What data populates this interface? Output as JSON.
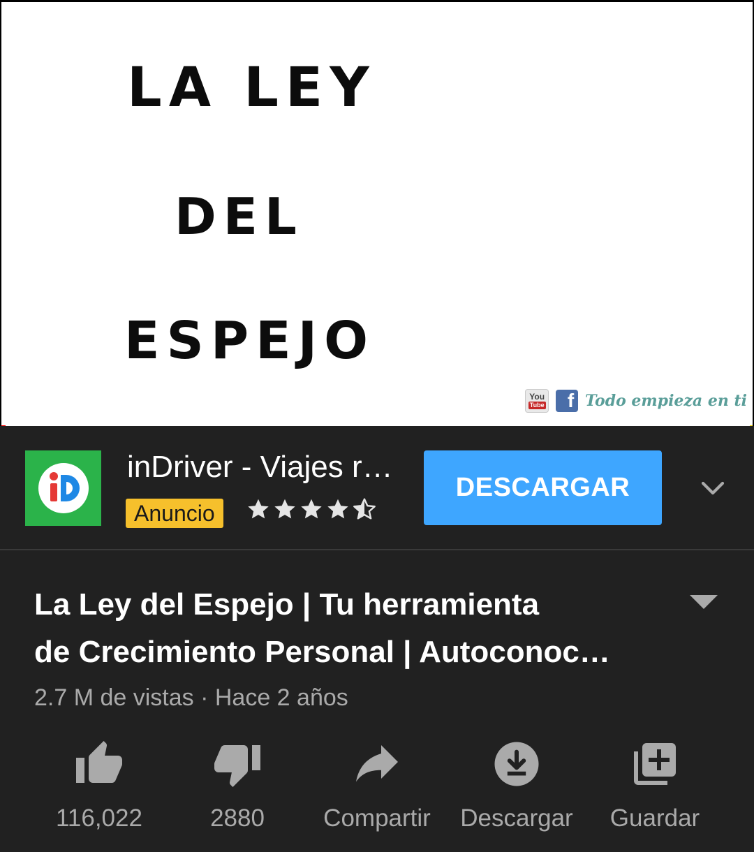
{
  "video": {
    "frame_lines": [
      "LA LEY",
      "DEL",
      "ESPEJO"
    ],
    "watermark": {
      "youtube_you": "You",
      "youtube_tube": "Tube",
      "facebook": "f",
      "text": "Todo empieza en ti"
    },
    "progress_fraction": 0.005
  },
  "ad": {
    "title": "inDriver - Viajes r…",
    "badge": "Anuncio",
    "rating_stars": 4.5,
    "cta": "DESCARGAR",
    "icon": "chevron-down-icon",
    "colors": {
      "logo_bg": "#2bb34a",
      "badge_bg": "#f6c02c",
      "cta_bg": "#3ea6ff"
    }
  },
  "info": {
    "title_line1": "La Ley del Espejo | Tu herramienta",
    "title_line2": "de Crecimiento Personal | Autoconoc…",
    "meta": "2.7 M de vistas · Hace 2 años"
  },
  "actions": [
    {
      "label": "116,022",
      "icon": "thumbs-up-icon"
    },
    {
      "label": "2880",
      "icon": "thumbs-down-icon"
    },
    {
      "label": "Compartir",
      "icon": "share-icon"
    },
    {
      "label": "Descargar",
      "icon": "download-icon"
    },
    {
      "label": "Guardar",
      "icon": "add-to-playlist-icon"
    }
  ]
}
